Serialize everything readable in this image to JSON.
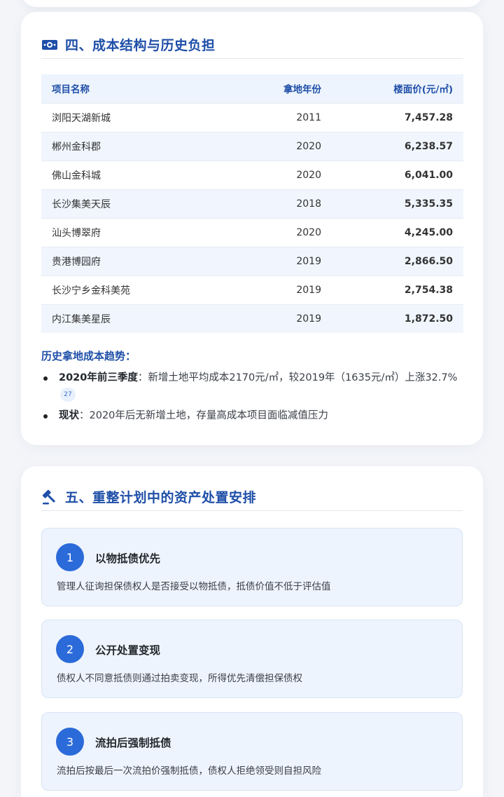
{
  "section4": {
    "title": "四、成本结构与历史负担",
    "icon": "money-bill-icon",
    "table": {
      "headers": [
        "项目名称",
        "拿地年份",
        "楼面价(元/㎡)"
      ],
      "rows": [
        {
          "name": "浏阳天湖新城",
          "year": "2011",
          "price": "7,457.28"
        },
        {
          "name": "郴州金科郡",
          "year": "2020",
          "price": "6,238.57"
        },
        {
          "name": "佛山金科城",
          "year": "2020",
          "price": "6,041.00"
        },
        {
          "name": "长沙集美天辰",
          "year": "2018",
          "price": "5,335.35"
        },
        {
          "name": "汕头博翠府",
          "year": "2020",
          "price": "4,245.00"
        },
        {
          "name": "贵港博园府",
          "year": "2019",
          "price": "2,866.50"
        },
        {
          "name": "长沙宁乡金科美苑",
          "year": "2019",
          "price": "2,754.38"
        },
        {
          "name": "内江集美星辰",
          "year": "2019",
          "price": "1,872.50"
        }
      ]
    },
    "trend_title": "历史拿地成本趋势：",
    "trend_items": [
      {
        "label": "2020年前三季度",
        "text": "：新增土地平均成本2170元/㎡，较2019年（1635元/㎡）上涨32.7%",
        "cite": "27"
      },
      {
        "label": "现状",
        "text": "：2020年后无新增土地，存量高成本项目面临减值压力"
      }
    ]
  },
  "section5": {
    "title": "五、重整计划中的资产处置安排",
    "icon": "gavel-icon",
    "steps": [
      {
        "num": "1",
        "title": "以物抵债优先",
        "desc": "管理人征询担保债权人是否接受以物抵债，抵债价值不低于评估值"
      },
      {
        "num": "2",
        "title": "公开处置变现",
        "desc": "债权人不同意抵债则通过拍卖变现，所得优先清偿担保债权"
      },
      {
        "num": "3",
        "title": "流拍后强制抵债",
        "desc": "流拍后按最后一次流拍价强制抵债，债权人拒绝领受则自担风险"
      }
    ]
  },
  "colors": {
    "accent": "#1f4fa8",
    "step_circle": "#2b6ad9",
    "row_alt": "#f1f6fe"
  }
}
